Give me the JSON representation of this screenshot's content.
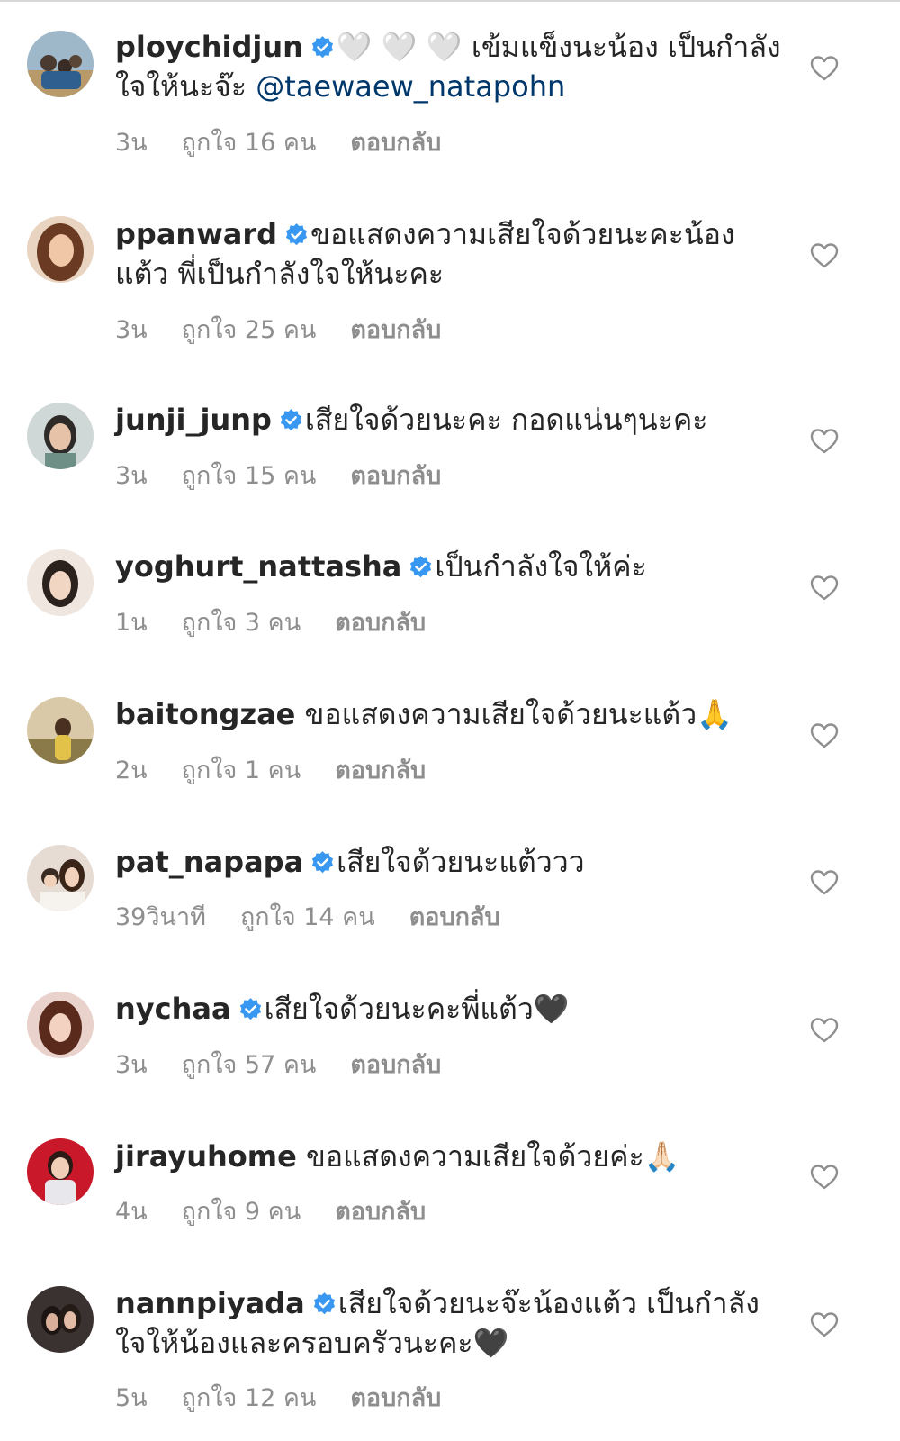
{
  "accent_color": "#3897f0",
  "icons": {
    "verified": "verified-badge-icon",
    "like": "heart-outline-icon"
  },
  "comments": [
    {
      "username": "ploychidjun",
      "verified": true,
      "emoji_lead": "🤍 🤍 🤍",
      "text": " เข้มแข็งนะน้อง เป็นกำลังใจให้นะจ๊ะ ",
      "mention": "@taewaew_natapohn",
      "time": "3น",
      "likes": "ถูกใจ 16 คน",
      "reply": "ตอบกลับ"
    },
    {
      "username": "ppanward",
      "verified": true,
      "text": "ขอแสดงความเสียใจด้วยนะคะน้องแต้ว พี่เป็นกำลังใจให้นะคะ",
      "time": "3น",
      "likes": "ถูกใจ 25 คน",
      "reply": "ตอบกลับ"
    },
    {
      "username": "junji_junp",
      "verified": true,
      "text": "เสียใจด้วยนะคะ กอดแน่นๆนะคะ",
      "time": "3น",
      "likes": "ถูกใจ 15 คน",
      "reply": "ตอบกลับ"
    },
    {
      "username": "yoghurt_nattasha",
      "verified": true,
      "text": "เป็นกำลังใจให้ค่ะ",
      "time": "1น",
      "likes": "ถูกใจ 3 คน",
      "reply": "ตอบกลับ"
    },
    {
      "username": "baitongzae",
      "verified": false,
      "text": "ขอแสดงความเสียใจด้วยนะแต้ว🙏",
      "time": "2น",
      "likes": "ถูกใจ 1 คน",
      "reply": "ตอบกลับ"
    },
    {
      "username": "pat_napapa",
      "verified": true,
      "text": "เสียใจด้วยนะแต้ววว",
      "time": "39วินาที",
      "likes": "ถูกใจ 14 คน",
      "reply": "ตอบกลับ"
    },
    {
      "username": "nychaa",
      "verified": true,
      "text": "เสียใจด้วยนะคะพี่แต้ว🖤",
      "time": "3น",
      "likes": "ถูกใจ 57 คน",
      "reply": "ตอบกลับ"
    },
    {
      "username": "jirayuhome",
      "verified": false,
      "text": "ขอแสดงความเสียใจด้วยค่ะ🙏🏻",
      "time": "4น",
      "likes": "ถูกใจ 9 คน",
      "reply": "ตอบกลับ"
    },
    {
      "username": "nannpiyada",
      "verified": true,
      "text": "เสียใจด้วยนะจ๊ะน้องแต้ว เป็นกำลังใจให้น้องและครอบครัวนะคะ🖤",
      "time": "5น",
      "likes": "ถูกใจ 12 คน",
      "reply": "ตอบกลับ"
    }
  ]
}
